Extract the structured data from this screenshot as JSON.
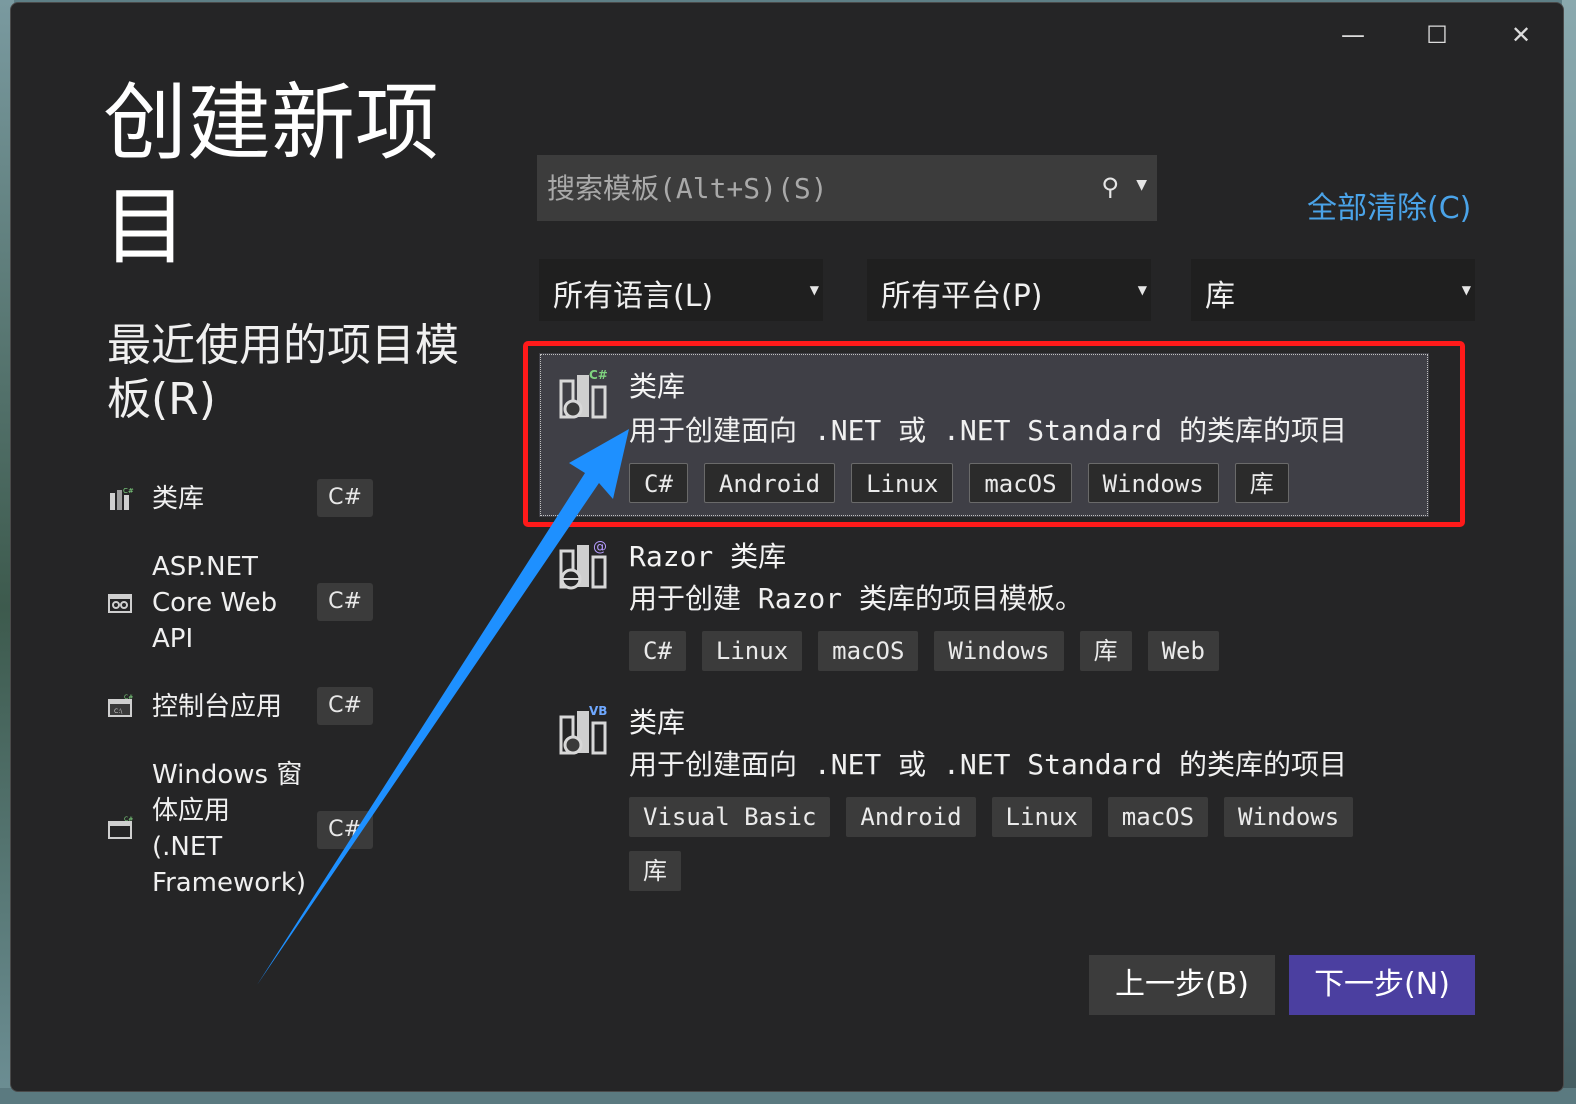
{
  "window": {
    "title_line1": "创建新项",
    "title_line2": "目",
    "controls": {
      "minimize": "—",
      "maximize": "☐",
      "close": "✕"
    }
  },
  "recent": {
    "title_line1": "最近使用的项目模",
    "title_line2": "板(R)",
    "items": [
      {
        "label": "类库",
        "lang": "C#",
        "icon": "class-library-icon"
      },
      {
        "label": "ASP.NET\nCore Web\nAPI",
        "lang": "C#",
        "icon": "web-api-icon"
      },
      {
        "label": "控制台应用",
        "lang": "C#",
        "icon": "console-app-icon"
      },
      {
        "label": "Windows 窗\n体应用\n(.NET\nFramework)",
        "lang": "C#",
        "icon": "windows-form-icon"
      }
    ]
  },
  "search": {
    "placeholder": "搜索模板(Alt+S)(S)",
    "icon": "search-icon"
  },
  "clear_all": "全部清除(C)",
  "filters": {
    "language": "所有语言(L)",
    "platform": "所有平台(P)",
    "project_type": "库"
  },
  "templates": [
    {
      "name": "类库",
      "description": "用于创建面向 .NET 或 .NET Standard 的类库的项目",
      "tags": [
        "C#",
        "Android",
        "Linux",
        "macOS",
        "Windows",
        "库"
      ],
      "badge": "C#",
      "selected": true
    },
    {
      "name": "Razor 类库",
      "description": "用于创建 Razor 类库的项目模板。",
      "tags": [
        "C#",
        "Linux",
        "macOS",
        "Windows",
        "库",
        "Web"
      ],
      "badge": "@",
      "selected": false
    },
    {
      "name": "类库",
      "description": "用于创建面向 .NET 或 .NET Standard 的类库的项目",
      "tags": [
        "Visual Basic",
        "Android",
        "Linux",
        "macOS",
        "Windows",
        "库"
      ],
      "badge": "VB",
      "selected": false
    }
  ],
  "buttons": {
    "back": "上一步(B)",
    "next": "下一步(N)"
  },
  "colors": {
    "highlight_box": "#ff1a1a",
    "arrow": "#1e90ff",
    "next_button": "#4b3fa0",
    "link": "#4aa3e8"
  }
}
